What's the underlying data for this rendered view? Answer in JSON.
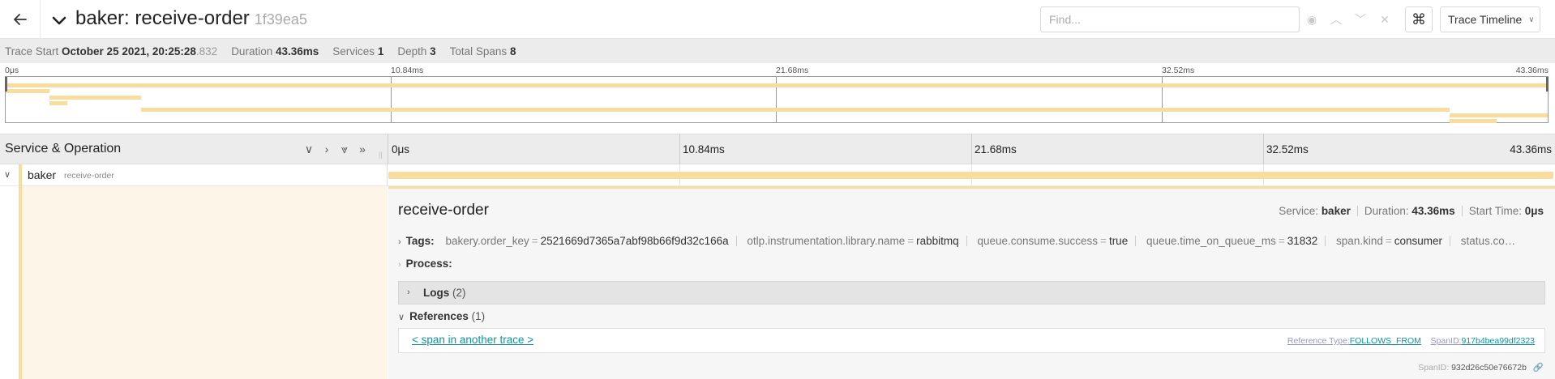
{
  "header": {
    "service": "baker",
    "separator": ":",
    "operation": "receive-order",
    "trace_id": "1f39ea5",
    "find_placeholder": "Find...",
    "cmd_glyph": "⌘",
    "view_label": "Trace Timeline"
  },
  "summary": {
    "trace_start_label": "Trace Start",
    "trace_start_value": "October 25 2021, 20:25:28",
    "trace_start_ms": ".832",
    "duration_label": "Duration",
    "duration_value": "43.36ms",
    "services_label": "Services",
    "services_value": "1",
    "depth_label": "Depth",
    "depth_value": "3",
    "total_spans_label": "Total Spans",
    "total_spans_value": "8"
  },
  "minimap": {
    "ticks": [
      "0μs",
      "10.84ms",
      "21.68ms",
      "32.52ms",
      "43.36ms"
    ]
  },
  "timeline": {
    "column_title": "Service & Operation",
    "ticks": [
      "0μs",
      "10.84ms",
      "21.68ms",
      "32.52ms",
      "43.36ms"
    ]
  },
  "span_row": {
    "service": "baker",
    "operation": "receive-order"
  },
  "detail": {
    "title": "receive-order",
    "service_label": "Service:",
    "service_value": "baker",
    "duration_label": "Duration:",
    "duration_value": "43.36ms",
    "start_label": "Start Time:",
    "start_value": "0μs",
    "tags_label": "Tags:",
    "tags": [
      {
        "key": "bakery.order_key",
        "value": "2521669d7365a7abf98b66f9d32c166a"
      },
      {
        "key": "otlp.instrumentation.library.name",
        "value": "rabbitmq"
      },
      {
        "key": "queue.consume.success",
        "value": "true"
      },
      {
        "key": "queue.time_on_queue_ms",
        "value": "31832"
      },
      {
        "key": "span.kind",
        "value": "consumer"
      },
      {
        "key": "status.co…",
        "value": ""
      }
    ],
    "process_label": "Process:",
    "logs_label": "Logs",
    "logs_count": "(2)",
    "references_label": "References",
    "references_count": "(1)",
    "reference_link": "< span in another trace >",
    "reference_type_label": "Reference Type:",
    "reference_type_value": "FOLLOWS_FROM",
    "reference_spanid_label": "SpanID:",
    "reference_spanid_value": "917b4bea99df2323",
    "spanid_label": "SpanID:",
    "spanid_value": "932d26c50e76672b"
  },
  "colors": {
    "span_bar": "#f8dd9e",
    "span_fill": "#fdf5e7",
    "link": "#11939a"
  }
}
